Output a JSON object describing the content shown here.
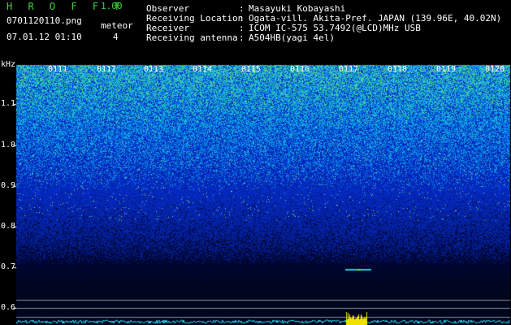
{
  "header": {
    "app_title": "H R O F F T",
    "app_version": "1.00",
    "file_name": "0701120110.png",
    "datetime": "07.01.12 01:10",
    "meteor_label": "meteor",
    "meteor_count": "4"
  },
  "info": [
    {
      "key": "Observer",
      "value": "Masayuki Kobayashi"
    },
    {
      "key": "Receiving Location",
      "value": "Ogata-vill. Akita-Pref. JAPAN (139.96E, 40.02N)"
    },
    {
      "key": "Receiver",
      "value": "ICOM IC-575 53.7492(@LCD)MHz USB"
    },
    {
      "key": "Receiving antenna",
      "value": "A504HB(yagi 4el)"
    }
  ],
  "colon": ":",
  "spectrogram": {
    "freq_unit": "kHz",
    "freq_ticks": [
      "1.1",
      "1.0",
      "0.9",
      "0.8",
      "0.7",
      "0.6"
    ],
    "time_ticks": [
      "0111",
      "0112",
      "0113",
      "0114",
      "0115",
      "0116",
      "0117",
      "0118",
      "0119",
      "0120"
    ],
    "colors": {
      "noise_dark": "#000c3a",
      "noise_blue": "#0a3cd6",
      "noise_cyan": "#22c8d0",
      "noise_green": "#5ee85e",
      "level_trace": "#28d8f0",
      "meteor_burst": "#f0e000",
      "baseline": "#8a8a8a"
    }
  }
}
